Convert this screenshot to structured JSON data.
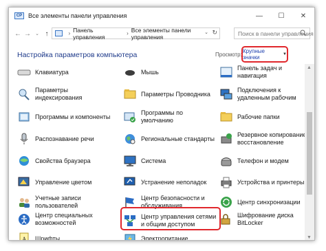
{
  "window": {
    "title": "Все элементы панели управления",
    "minimize": "—",
    "maximize": "☐",
    "close": "✕"
  },
  "address": {
    "icon": "control-panel-icon",
    "crumb1": "Панель управления",
    "crumb2": "Все элементы панели управления",
    "separator": "›",
    "search_placeholder": "Поиск в панели управления"
  },
  "header": {
    "title": "Настройка параметров компьютера",
    "view_label": "Просмотр:",
    "view_value": "Крупные значки"
  },
  "colors": {
    "accent_red": "#e0262b",
    "link_blue": "#1e3a8a"
  },
  "items": {
    "col1": [
      {
        "label": "Клавиатура",
        "icon": "keyboard-icon"
      },
      {
        "label": "Параметры индексирования",
        "icon": "indexing-icon"
      },
      {
        "label": "Программы и компоненты",
        "icon": "programs-icon"
      },
      {
        "label": "Распознавание речи",
        "icon": "microphone-icon"
      },
      {
        "label": "Свойства браузера",
        "icon": "globe-icon"
      },
      {
        "label": "Управление цветом",
        "icon": "color-icon"
      },
      {
        "label": "Учетные записи пользователей",
        "icon": "users-icon"
      },
      {
        "label": "Центр специальных возможностей",
        "icon": "accessibility-icon"
      },
      {
        "label": "Шрифты",
        "icon": "fonts-icon"
      }
    ],
    "col2": [
      {
        "label": "Мышь",
        "icon": "mouse-icon"
      },
      {
        "label": "Параметры Проводника",
        "icon": "folder-options-icon"
      },
      {
        "label": "Программы по умолчанию",
        "icon": "default-programs-icon"
      },
      {
        "label": "Региональные стандарты",
        "icon": "region-icon"
      },
      {
        "label": "Система",
        "icon": "system-icon"
      },
      {
        "label": "Устранение неполадок",
        "icon": "troubleshoot-icon"
      },
      {
        "label": "Центр безопасности и обслуживания",
        "icon": "security-flag-icon"
      },
      {
        "label": "Центр управления сетями и общим доступом",
        "icon": "network-icon"
      },
      {
        "label": "Электропитание",
        "icon": "power-icon"
      }
    ],
    "col3": [
      {
        "label": "Панель задач и навигация",
        "icon": "taskbar-icon"
      },
      {
        "label": "Подключения к удаленным рабочим",
        "icon": "remote-icon"
      },
      {
        "label": "Рабочие папки",
        "icon": "work-folders-icon"
      },
      {
        "label": "Резервное копирование и восстановление",
        "icon": "backup-icon"
      },
      {
        "label": "Телефон и модем",
        "icon": "phone-icon"
      },
      {
        "label": "Устройства и принтеры",
        "icon": "printer-icon"
      },
      {
        "label": "Центр синхронизации",
        "icon": "sync-icon"
      },
      {
        "label": "Шифрование диска BitLocker",
        "icon": "bitlocker-icon"
      }
    ]
  }
}
